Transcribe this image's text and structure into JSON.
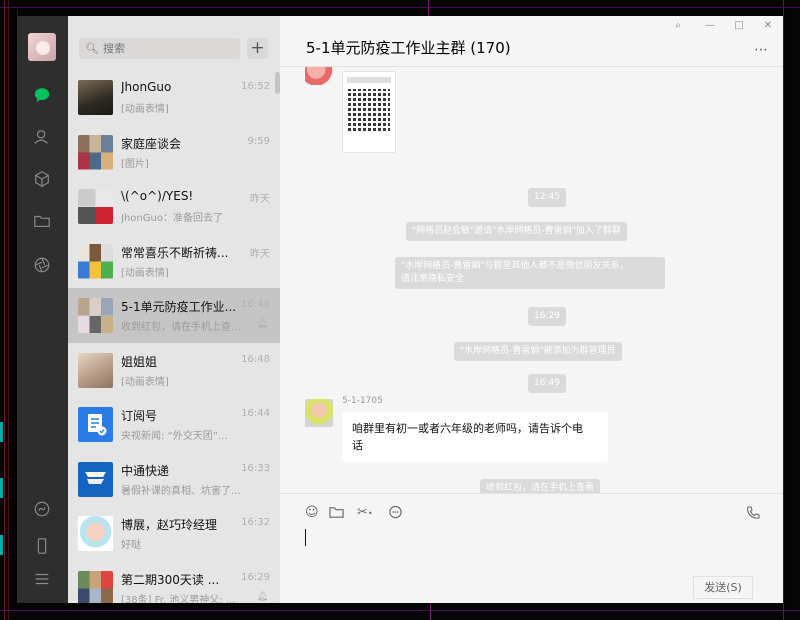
{
  "window": {
    "title": "5-1单元防疫工作业主群 (170)"
  },
  "search": {
    "placeholder": "搜索"
  },
  "chats": [
    {
      "name": "JhonGuo",
      "preview": "[动画表情]",
      "time": "16:52"
    },
    {
      "name": "家庭座谈会",
      "preview": "[图片]",
      "time": "9:59"
    },
    {
      "name": "\\(^o^)/YES!",
      "preview": "JhonGuo：准备回去了",
      "time": "昨天"
    },
    {
      "name": "常常喜乐不断祈祷...",
      "preview": "[动画表情]",
      "time": "昨天"
    },
    {
      "name": "5-1单元防疫工作业...",
      "preview": "收到红包，请在手机上查...",
      "time": "16:49",
      "selected": true
    },
    {
      "name": "姐姐姐",
      "preview": "[动画表情]",
      "time": "16:48"
    },
    {
      "name": "订阅号",
      "preview": "央视新闻: “外交天团”...",
      "time": "16:44"
    },
    {
      "name": "中通快递",
      "preview": "暑假补课的真相、坑害了...",
      "time": "16:33"
    },
    {
      "name": "博展，赵巧玲经理",
      "preview": "好哒",
      "time": "16:32"
    },
    {
      "name": "第二期300天读 ...",
      "preview": "[38条] Fr. 池义男神父: ...",
      "time": "16:29"
    }
  ],
  "messages": {
    "time1": "12:45",
    "sys1": "\"网格员赵会敏\"邀请\"水岸网格员-曹雷娟\"加入了群聊",
    "sys2_line1": "\"水岸网格员-曹雷娟\"与群里其他人都不是微信朋友关系，",
    "sys2_line2": "请注意隐私安全",
    "time2": "16:29",
    "sys3": "\"水岸网格员-曹雷娟\"被添加为群管理员",
    "time3": "16:49",
    "sender": "5-1-1705",
    "bubble_line1": "咱群里有初一或者六年级的老师吗，请告诉个电",
    "bubble_line2": "话",
    "sys4": "收到红包，请在手机上查看"
  },
  "compose": {
    "send_label": "发送(S)"
  },
  "icons": {
    "emoji": "emoji-icon",
    "folder": "folder-icon",
    "scissors": "scissors-icon",
    "bubble": "chat-bubble-icon",
    "phone": "phone-icon"
  }
}
